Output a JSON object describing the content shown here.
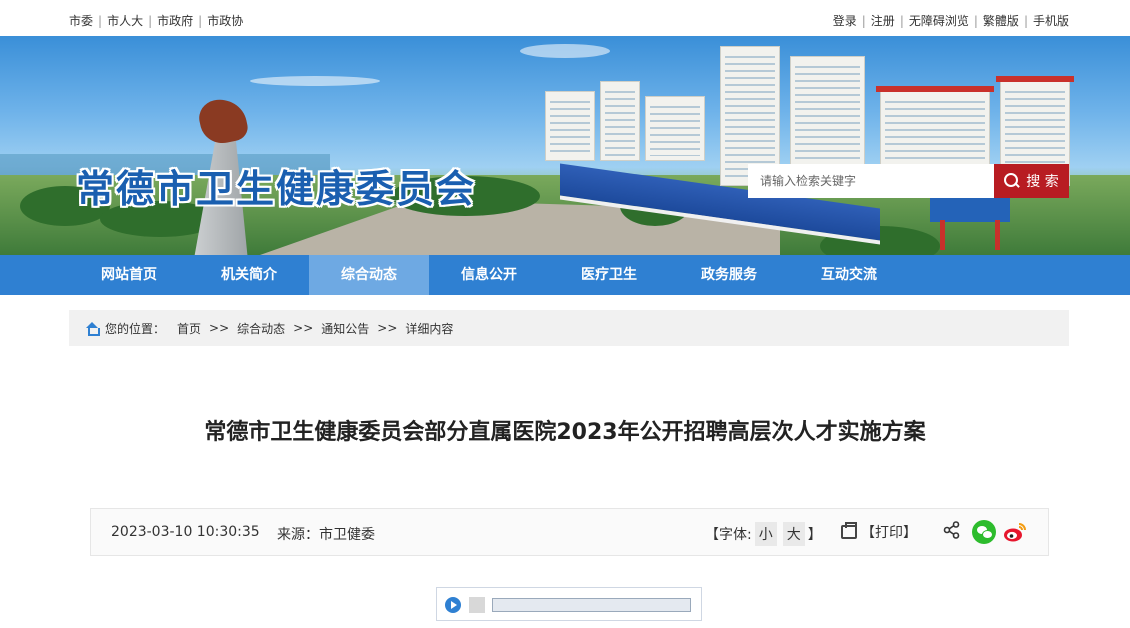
{
  "topbar": {
    "left_links": [
      "市委",
      "市人大",
      "市政府",
      "市政协"
    ],
    "right_links": [
      "登录",
      "注册",
      "无障碍浏览",
      "繁體版",
      "手机版"
    ],
    "separator": "|"
  },
  "banner": {
    "site_title": "常德市卫生健康委员会"
  },
  "search": {
    "placeholder": "请输入检索关键字",
    "button_label": "搜 索",
    "button_color": "#b81c22"
  },
  "nav": {
    "items": [
      "网站首页",
      "机关简介",
      "综合动态",
      "信息公开",
      "医疗卫生",
      "政务服务",
      "互动交流"
    ],
    "active_index": 2,
    "bg_color": "#2f80d2",
    "active_color": "#6ea9e3"
  },
  "breadcrumb": {
    "label": "您的位置：",
    "items": [
      "首页",
      "综合动态",
      "通知公告",
      "详细内容"
    ],
    "separator": ">>"
  },
  "article": {
    "title": "常德市卫生健康委员会部分直属医院2023年公开招聘高层次人才实施方案",
    "date": "2023-03-10 10:30:35",
    "source": "来源：市卫健委",
    "font_label_open": "【字体:",
    "font_small": "小",
    "font_large": "大",
    "font_label_close": "】",
    "print_label": "【打印】"
  },
  "player": {
    "progress": 0
  }
}
